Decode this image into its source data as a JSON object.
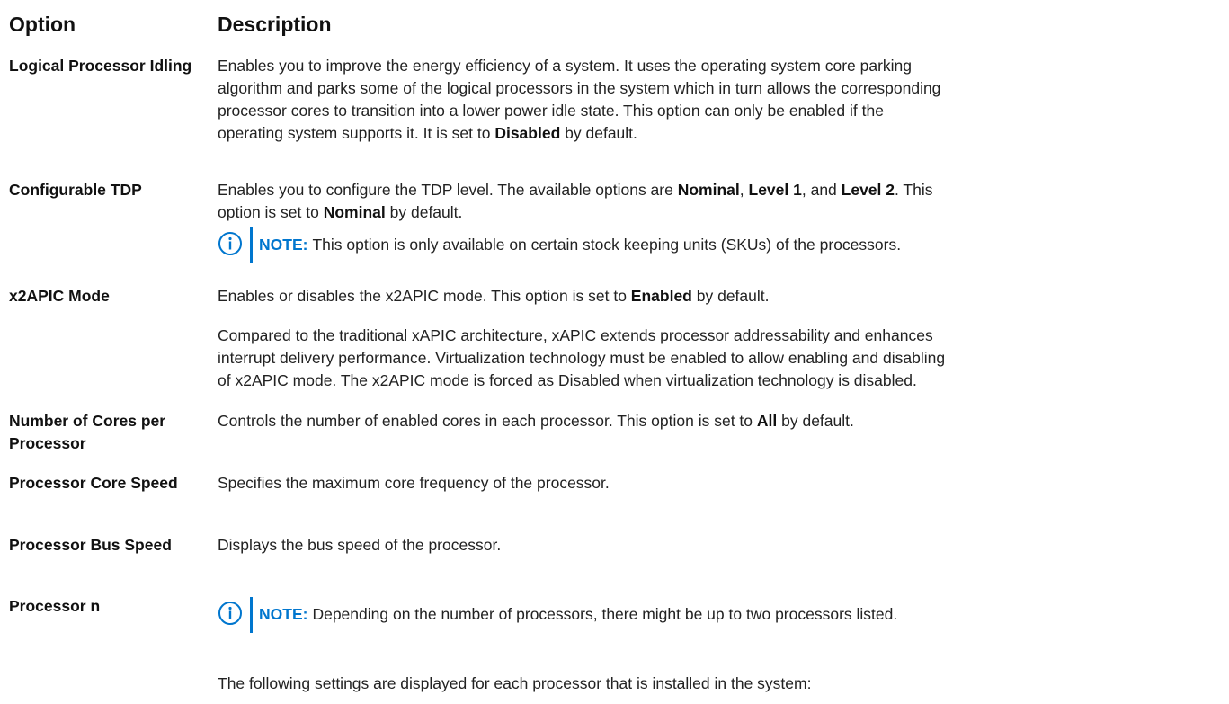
{
  "header": {
    "option": "Option",
    "description": "Description"
  },
  "rows": [
    {
      "option": "Logical Processor Idling",
      "desc_lines": [
        "Enables you to improve the energy efficiency of a system. It uses the operating system core parking",
        "algorithm and parks some of the logical processors in the system which in turn allows the corresponding",
        "processor cores to transition into a lower power idle state. This option can only be enabled if the"
      ],
      "desc_last_pre": "operating system supports it. It is set to ",
      "desc_last_bold": "Disabled",
      "desc_last_post": " by default."
    },
    {
      "option": "Configurable TDP",
      "line1_pre": "Enables you to configure the TDP level. The available options are ",
      "b1": "Nominal",
      "sep1": ", ",
      "b2": "Level 1",
      "sep2": ", and ",
      "b3": "Level 2",
      "line1_post": ". This",
      "line2_pre": "option is set to ",
      "b4": "Nominal",
      "line2_post": " by default.",
      "note_label": "NOTE:",
      "note_text": "This option is only available on certain stock keeping units (SKUs) of the processors."
    },
    {
      "option": "x2APIC Mode",
      "line1_pre": "Enables or disables the x2APIC mode. This option is set to ",
      "b1": "Enabled",
      "line1_post": " by default.",
      "para_lines": [
        "Compared to the traditional xAPIC architecture, xAPIC extends processor addressability and enhances",
        "interrupt delivery performance. Virtualization technology must be enabled to allow enabling and disabling",
        "of x2APIC mode. The x2APIC mode is forced as Disabled when virtualization technology is disabled."
      ]
    },
    {
      "option": "Number of Cores per Processor",
      "line1_pre": "Controls the number of enabled cores in each processor. This option is set to ",
      "b1": "All",
      "line1_post": " by default."
    },
    {
      "option": "Processor Core Speed",
      "desc": "Specifies the maximum core frequency of the processor."
    },
    {
      "option": "Processor Bus Speed",
      "desc": "Displays the bus speed of the processor."
    },
    {
      "option": "Processor n",
      "note_label": "NOTE:",
      "note_text": "Depending on the number of processors, there might be up to two processors listed.",
      "desc": "The following settings are displayed for each processor that is installed in the system:"
    }
  ],
  "icons": {
    "note": "info-circle-icon"
  },
  "colors": {
    "accent": "#0076ce"
  }
}
